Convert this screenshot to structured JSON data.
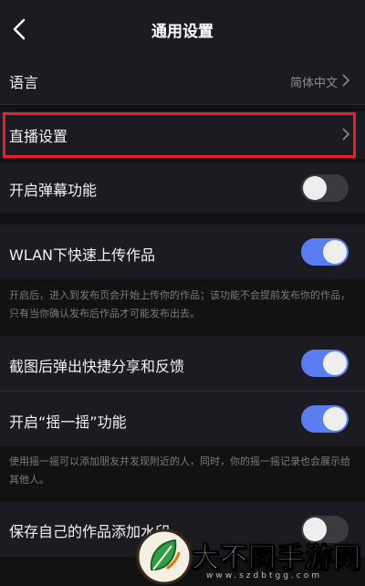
{
  "header": {
    "title": "通用设置"
  },
  "settings": {
    "language": {
      "label": "语言",
      "value": "简体中文"
    },
    "live": {
      "label": "直播设置"
    },
    "danmaku": {
      "label": "开启弹幕功能",
      "enabled": false
    },
    "wlan": {
      "label": "WLAN下快速上传作品",
      "enabled": true
    },
    "wlan_note": "开启后，进入到发布页会开始上传你的作品；该功能不会提前发布你的作品，只有当你确认发布后作品才可能发布出去。",
    "screenshot": {
      "label": "截图后弹出快捷分享和反馈",
      "enabled": true
    },
    "shake": {
      "label": "开启“摇一摇”功能",
      "enabled": true
    },
    "shake_note": "使用摇一摇可以添加朋友并发现附近的人，同时，你的摇一摇记录也会展示给其他人。",
    "watermark": {
      "label": "保存自己的作品添加水印",
      "enabled": false
    }
  },
  "watermark_logo": {
    "text": "大不同手游网",
    "url": "www.szdbtgg.com"
  },
  "colors": {
    "toggle_on": "#5a7ef0",
    "highlight": "#e8202e"
  }
}
